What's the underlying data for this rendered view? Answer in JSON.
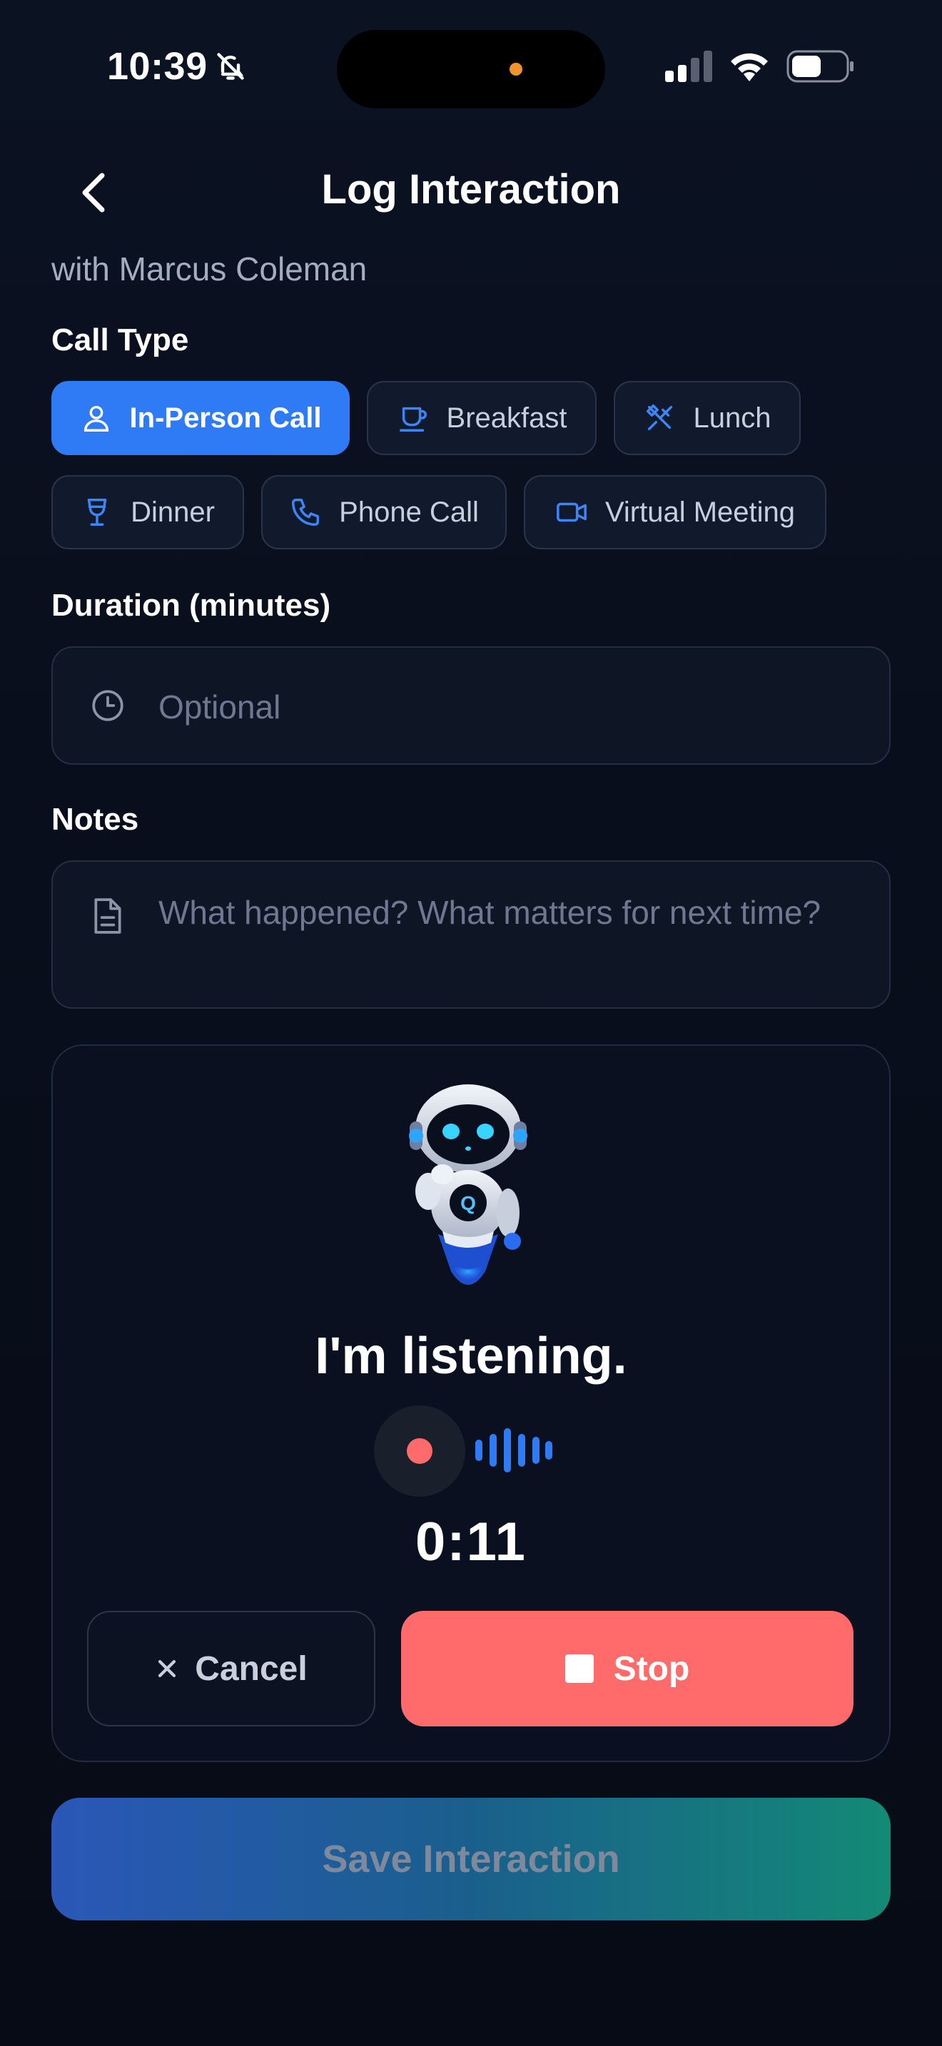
{
  "status_bar": {
    "time": "10:39"
  },
  "header": {
    "title": "Log Interaction",
    "subtitle": "with Marcus Coleman"
  },
  "call_type": {
    "label": "Call Type",
    "selected": "In-Person Call",
    "options": [
      {
        "label": "In-Person Call",
        "icon": "person-icon"
      },
      {
        "label": "Breakfast",
        "icon": "coffee-cup-icon"
      },
      {
        "label": "Lunch",
        "icon": "utensils-icon"
      },
      {
        "label": "Dinner",
        "icon": "wine-glass-icon"
      },
      {
        "label": "Phone Call",
        "icon": "phone-icon"
      },
      {
        "label": "Virtual Meeting",
        "icon": "video-camera-icon"
      }
    ]
  },
  "duration": {
    "label": "Duration (minutes)",
    "placeholder": "Optional"
  },
  "notes": {
    "label": "Notes",
    "placeholder": "What happened? What matters for next time?"
  },
  "voice": {
    "status": "I'm listening.",
    "timer": "0:11",
    "cancel_label": "Cancel",
    "stop_label": "Stop",
    "recording_color": "#ff6b6b"
  },
  "save_label": "Save Interaction",
  "colors": {
    "accent": "#2f7bf6",
    "stop": "#ff6b6b",
    "save_gradient_start": "#2a57b8",
    "save_gradient_end": "#138a76"
  }
}
